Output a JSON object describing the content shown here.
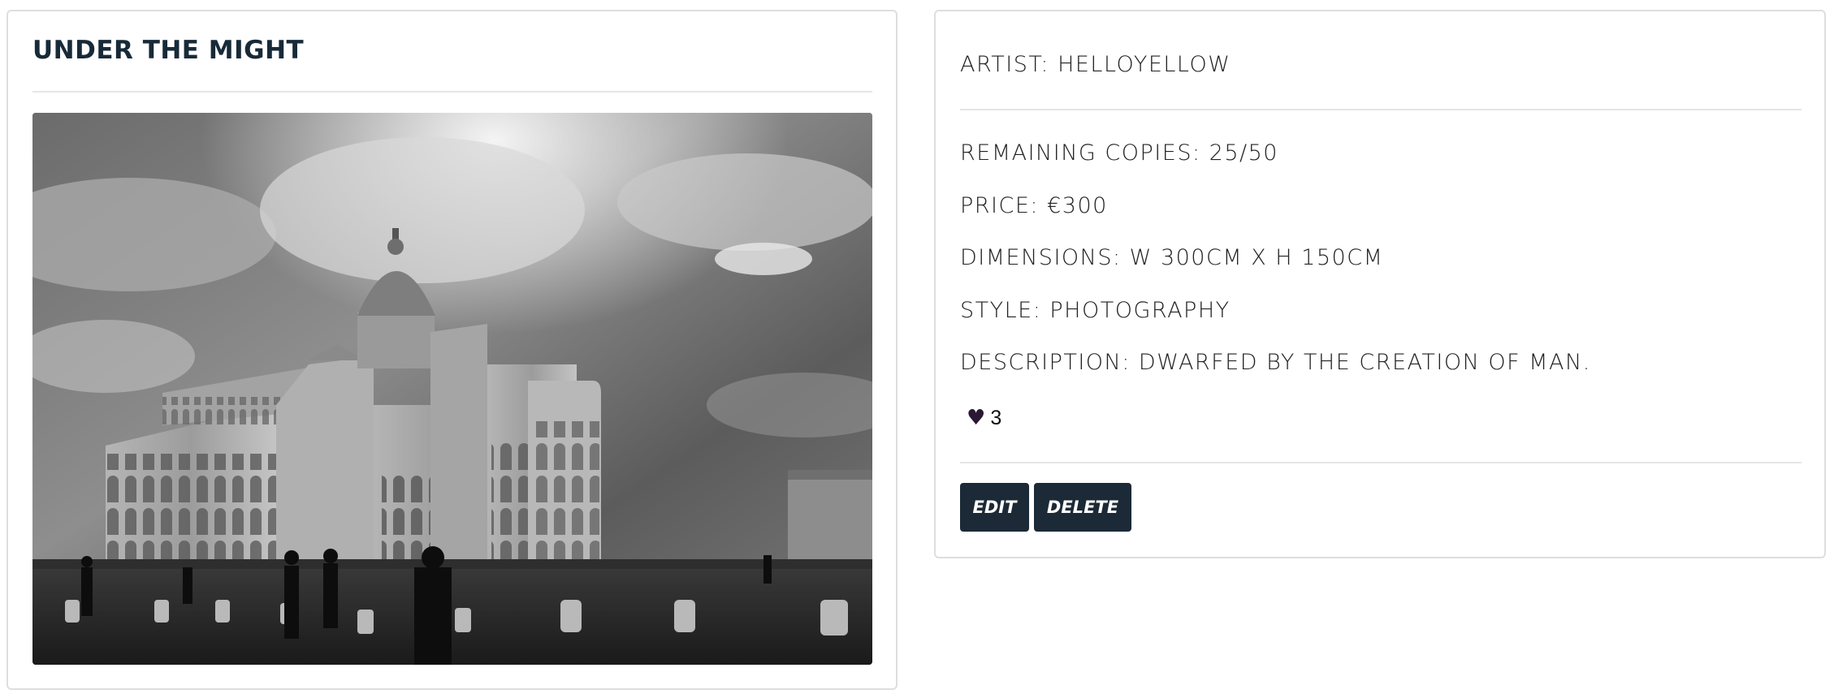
{
  "artwork": {
    "title": "UNDER THE MIGHT",
    "image_alt": "Black and white photograph of a cathedral"
  },
  "details": {
    "artist": "ARTIST: HELLOYELLOW",
    "remaining": "REMAINING COPIES: 25/50",
    "price": "PRICE: €300",
    "dimensions": "DIMENSIONS: W 300CM X H 150CM",
    "style": "STYLE: PHOTOGRAPHY",
    "description": "DESCRIPTION: DWARFED BY THE CREATION OF MAN."
  },
  "likes": {
    "icon": "heart-icon",
    "count": "3",
    "color": "#2a1833"
  },
  "actions": {
    "edit_label": "EDIT",
    "delete_label": "DELETE"
  },
  "colors": {
    "title": "#172a38",
    "button_bg": "#1b2a36",
    "button_text": "#ffffff",
    "border": "#dedede"
  }
}
